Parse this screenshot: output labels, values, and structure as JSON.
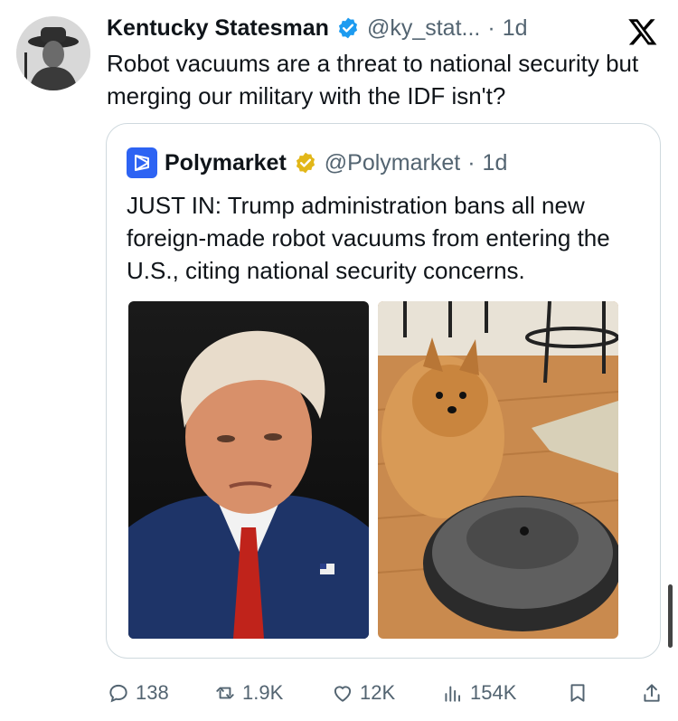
{
  "tweet": {
    "author_name": "Kentucky Statesman",
    "author_handle": "@ky_stat...",
    "separator": "·",
    "time": "1d",
    "text": "Robot vacuums are a threat to national security but merging our military with the IDF isn't?"
  },
  "quote": {
    "author_name": "Polymarket",
    "author_handle": "@Polymarket",
    "separator": "·",
    "time": "1d",
    "text": "JUST IN: Trump administration bans all new foreign-made robot vacuums from entering the U.S., citing national security concerns."
  },
  "actions": {
    "replies": "138",
    "reposts": "1.9K",
    "likes": "12K",
    "views": "154K"
  },
  "colors": {
    "verified_blue": "#1d9bf0",
    "verified_gold": "#e2b719",
    "muted": "#536471",
    "polymarket_blue": "#2d63f3"
  },
  "icons": [
    "verified-badge-icon",
    "x-logo-icon",
    "polymarket-logo-icon",
    "gold-verified-badge-icon",
    "reply-icon",
    "repost-icon",
    "like-icon",
    "views-icon",
    "bookmark-icon",
    "share-icon"
  ]
}
